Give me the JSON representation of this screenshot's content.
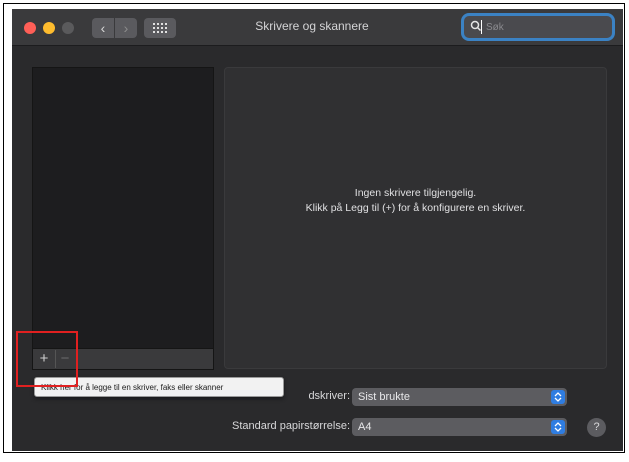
{
  "window": {
    "title": "Skrivere og skannere",
    "nav_back": "‹",
    "nav_forward": "›"
  },
  "search": {
    "placeholder": "Søk",
    "value": ""
  },
  "printer_list": {
    "add_symbol": "+",
    "remove_symbol": "−"
  },
  "detail": {
    "line1": "Ingen skrivere tilgjengelig.",
    "line2": "Klikk på Legg til (+) for å konfigurere en skriver."
  },
  "tooltip": {
    "text": "Klikk her for å legge til en skriver, faks eller skanner"
  },
  "settings": {
    "default_printer_label": "dskriver:",
    "default_printer_value": "Sist brukte",
    "paper_size_label": "Standard papirstørrelse:",
    "paper_size_value": "A4"
  },
  "help": {
    "symbol": "?"
  },
  "colors": {
    "close": "#ff5f57",
    "minimize": "#febc2e",
    "accent": "#2f7de1",
    "highlight": "#e02020"
  }
}
